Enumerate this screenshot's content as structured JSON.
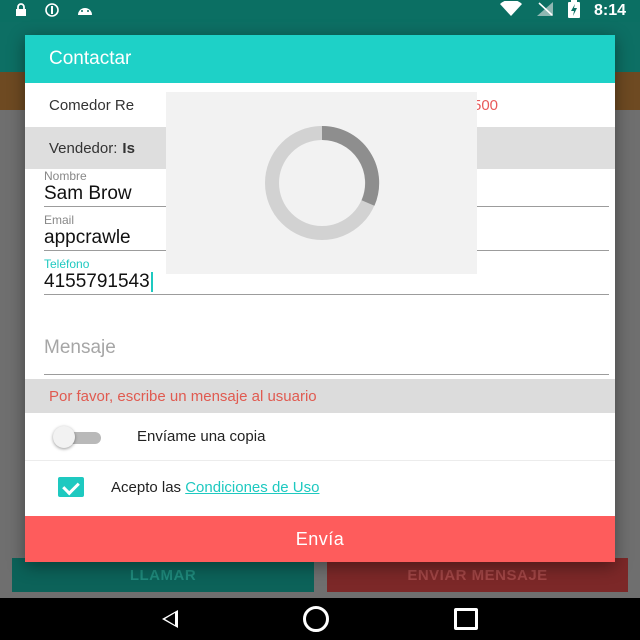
{
  "status_bar": {
    "time": "8:14",
    "left_icons": [
      "lock-icon",
      "circle-icon",
      "android-icon"
    ],
    "right_icons": [
      "wifi-icon",
      "no-signal-icon",
      "battery-charging-icon"
    ]
  },
  "background": {
    "call_button": "LLAMAR",
    "message_button": "ENVIAR MENSAJE"
  },
  "dialog": {
    "title": "Contactar",
    "product_text": "Comedor Re",
    "product_price": "500",
    "seller_label": "Vendedor:",
    "seller_name": "Is",
    "nombre": {
      "label": "Nombre",
      "value": "Sam Brow"
    },
    "email": {
      "label": "Email",
      "value": "appcrawle"
    },
    "telefono": {
      "label": "Teléfono",
      "value": "4155791543"
    },
    "mensaje_placeholder": "Mensaje",
    "error_text": "Por favor, escribe un mensaje al usuario",
    "copy_label": "Envíame una copia",
    "copy_enabled": false,
    "terms_prefix": "Acepto las",
    "terms_link": "Condiciones de Uso",
    "terms_checked": true,
    "send_label": "Envía"
  },
  "colors": {
    "accent": "#1ed1c7",
    "send": "#fe5c5c",
    "error": "#e05a50"
  }
}
